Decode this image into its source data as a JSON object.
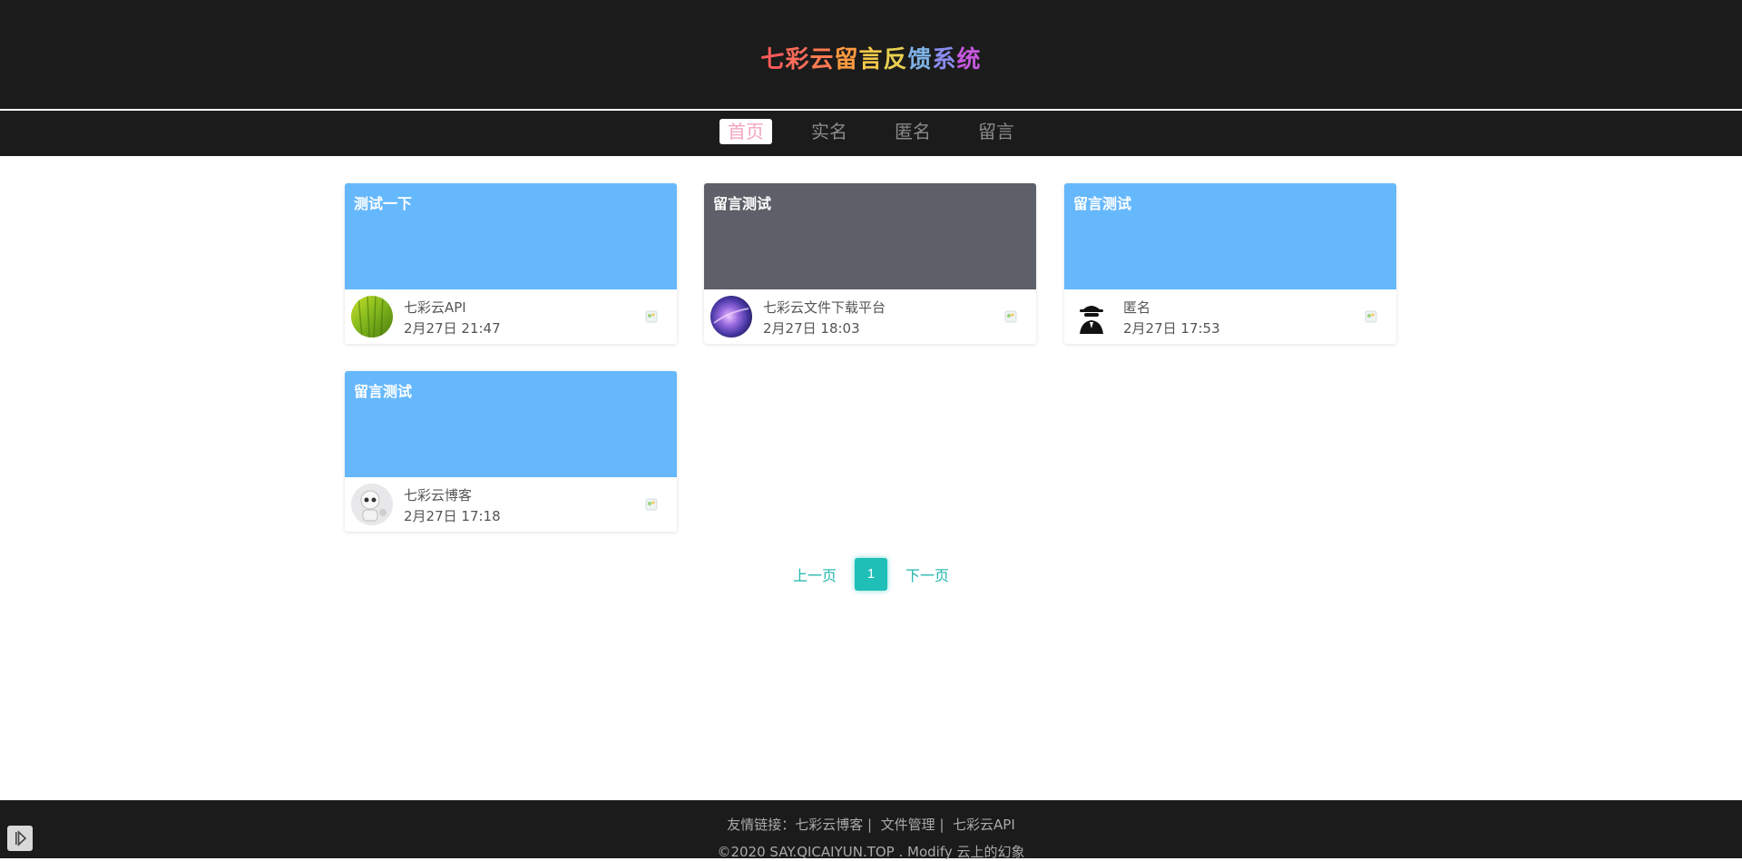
{
  "site": {
    "title_chars": [
      {
        "ch": "七",
        "color": "#ff5a5a"
      },
      {
        "ch": "彩",
        "color": "#ff6b5a"
      },
      {
        "ch": "云",
        "color": "#ff7a50"
      },
      {
        "ch": "留",
        "color": "#ff9a40"
      },
      {
        "ch": "言",
        "color": "#f6c84a"
      },
      {
        "ch": "反",
        "color": "#e8d050"
      },
      {
        "ch": "馈",
        "color": "#7fb2e6"
      },
      {
        "ch": "系",
        "color": "#8a8cf0"
      },
      {
        "ch": "统",
        "color": "#c659e0"
      }
    ]
  },
  "nav": {
    "items": [
      {
        "label": "首页",
        "active": true
      },
      {
        "label": "实名",
        "active": false
      },
      {
        "label": "匿名",
        "active": false
      },
      {
        "label": "留言",
        "active": false
      }
    ]
  },
  "cards": [
    {
      "title": "测试一下",
      "bg": "#66b8fc",
      "author": "七彩云API",
      "time": "2月27日 21:47",
      "avatar": "bamboo"
    },
    {
      "title": "留言测试",
      "bg": "#5d6068",
      "author": "七彩云文件下载平台",
      "time": "2月27日 18:03",
      "avatar": "galaxy"
    },
    {
      "title": "留言测试",
      "bg": "#66b8fc",
      "author": "匿名",
      "time": "2月27日 17:53",
      "avatar": "spy"
    },
    {
      "title": "留言测试",
      "bg": "#66b8fc",
      "author": "七彩云博客",
      "time": "2月27日 17:18",
      "avatar": "robot"
    }
  ],
  "pager": {
    "prev": "上一页",
    "current": "1",
    "next": "下一页"
  },
  "footer": {
    "links_prefix": "友情链接：",
    "links": [
      "七彩云博客",
      "文件管理",
      "七彩云API"
    ],
    "separator": "|",
    "copyright": "©2020 SAY.QICAIYUN.TOP . Modify 云上的幻象"
  },
  "colors": {
    "accent": "#1fbfb8",
    "header_bg": "#1b1b1b",
    "nav_active": "#f4a3c0"
  }
}
